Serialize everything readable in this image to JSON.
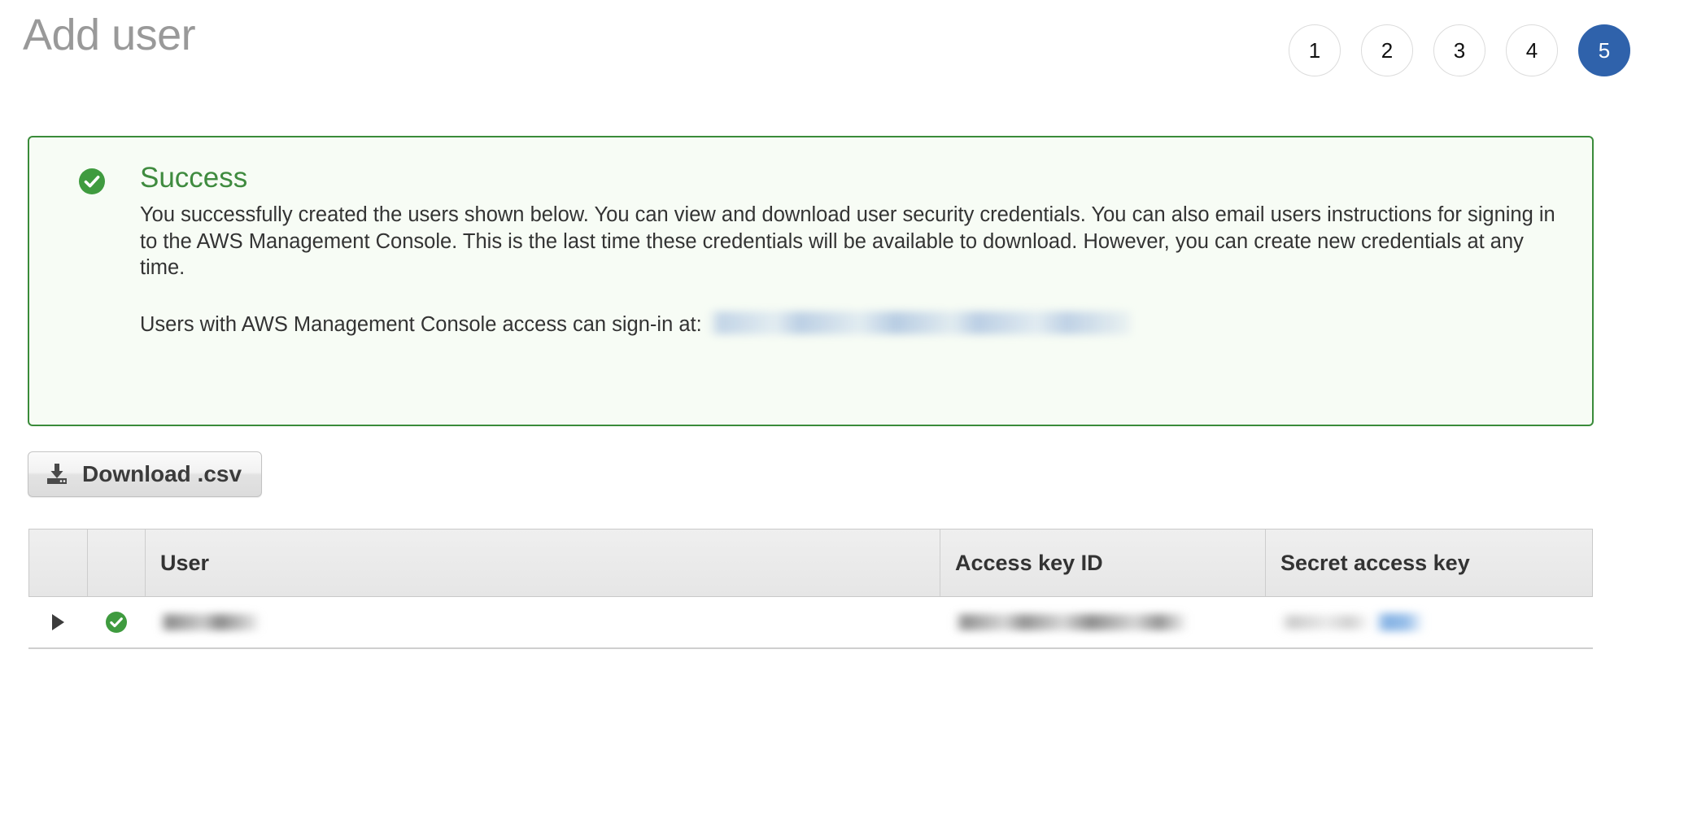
{
  "header": {
    "title": "Add user",
    "steps": [
      {
        "label": "1",
        "active": false
      },
      {
        "label": "2",
        "active": false
      },
      {
        "label": "3",
        "active": false
      },
      {
        "label": "4",
        "active": false
      },
      {
        "label": "5",
        "active": true
      }
    ],
    "active_step": 5,
    "active_step_color": "#2f62ab"
  },
  "alert": {
    "type": "success",
    "heading": "Success",
    "icon": "check-circle-icon",
    "border_color": "#3a8b3a",
    "background_color": "#f7fcf5",
    "heading_color": "#3f8b3f",
    "body": "You successfully created the users shown below. You can view and download user security credentials. You can also email users instructions for signing in to the AWS Management Console. This is the last time these credentials will be available to download. However, you can create new credentials at any time.",
    "signin_label": "Users with AWS Management Console access can sign-in at:",
    "signin_url": "",
    "signin_url_redacted": true
  },
  "toolbar": {
    "download_label": "Download .csv",
    "download_icon": "download-icon"
  },
  "table": {
    "columns": [
      {
        "key": "expand",
        "label": ""
      },
      {
        "key": "status",
        "label": ""
      },
      {
        "key": "user",
        "label": "User"
      },
      {
        "key": "access_key_id",
        "label": "Access key ID"
      },
      {
        "key": "secret_access_key",
        "label": "Secret access key"
      }
    ],
    "rows": [
      {
        "expander": "triangle-right-icon",
        "status_icon": "check-circle-icon",
        "user": "",
        "user_redacted": true,
        "access_key_id": "",
        "access_key_id_redacted": true,
        "secret_access_key": "",
        "secret_access_key_redacted": true,
        "show_link_label": "Show",
        "show_link_redacted": true
      }
    ]
  }
}
